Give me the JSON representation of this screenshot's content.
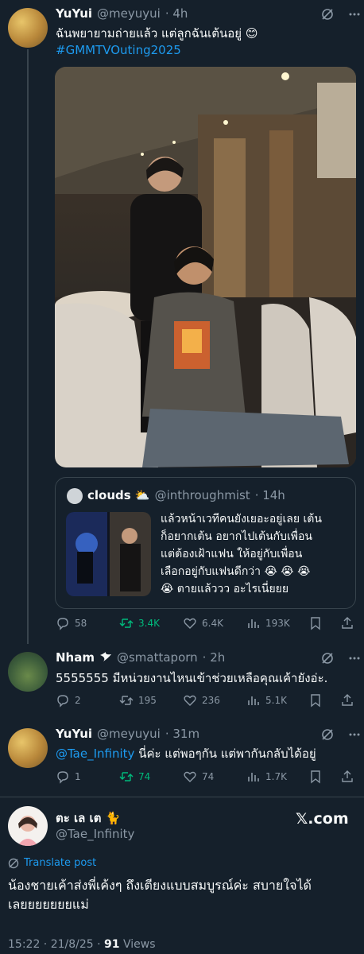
{
  "tweet1": {
    "name": "YuYui",
    "handle": "@meyuyui",
    "time": "· 4h",
    "text": "ฉันพยายามถ่ายแล้ว แต่ลูกฉันเต้นอยู่ 😊",
    "hashtag": "#GMMTVOuting2025",
    "quote": {
      "name": "clouds ⛅",
      "handle": "@inthroughmist",
      "time": "· 14h",
      "lines": [
        "แล้วหน้าเวทีคนยังเยอะอยู่เลย เต้น",
        "ก็อยากเต้น อยากไปเต้นกับเพื่อน",
        "แต่ต้องเฝ้าแฟน ให้อยู่กับเพื่อน",
        "เลือกอยู่กับแฟนดีกว่า 😭 😭 😭",
        "😭 ตายแล้ววว อะไรเนี่ยยย"
      ]
    },
    "stats": {
      "replies": "58",
      "retweets": "3.4K",
      "likes": "6.4K",
      "views": "193K"
    }
  },
  "tweet2": {
    "name": "Nham",
    "handle": "@smattaporn",
    "time": "· 2h",
    "text": "5555555 มีหน่วยงานไหนเข้าช่วยเหลือคุณเค้ายังอ่ะ.",
    "stats": {
      "replies": "2",
      "retweets": "195",
      "likes": "236",
      "views": "5.1K"
    }
  },
  "tweet3": {
    "name": "YuYui",
    "handle": "@meyuyui",
    "time": "· 31m",
    "mention": "@Tae_Infinity",
    "text": " นี่ค่ะ แต่พอๆกัน แต่พากันกลับได้อยู่",
    "stats": {
      "replies": "1",
      "retweets": "74",
      "likes": "74",
      "views": "1.7K"
    }
  },
  "main": {
    "name": "ตะ เล เต 🐈",
    "handle": "@Tae_Infinity",
    "brand": "𝕏.com",
    "translate": "Translate post",
    "text_line1": "น้องชายเค้าส่งพี่เค้งๆ ถึงเตียงแบบสมบูรณ์ค่ะ สบายใจได้",
    "text_line2": "เลยยยยยยยแม่",
    "time": "15:22 · 21/8/25 · ",
    "views_count": "91",
    "views_label": "Views"
  },
  "colors": {
    "bg": "#15202b",
    "text": "#f7f9f9",
    "dim": "#8b98a5",
    "link": "#1d9bf0",
    "retweet_active": "#00ba7c",
    "border": "#38444d"
  }
}
